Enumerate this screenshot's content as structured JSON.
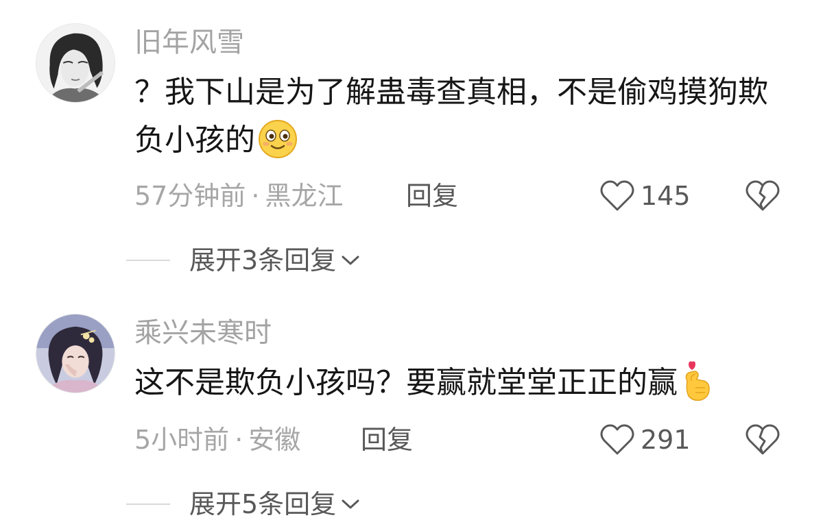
{
  "comments": [
    {
      "username": "旧年风雪",
      "content": "？我下山是为了解蛊毒查真相，不是偷鸡摸狗欺负小孩的",
      "content_emoji": "smiling-face-emoji",
      "time": "57分钟前",
      "separator": "·",
      "region": "黑龙江",
      "reply_label": "回复",
      "like_count": "145",
      "expand_label": "展开3条回复",
      "icons": {
        "like": "heart-outline-icon",
        "dislike": "broken-heart-icon",
        "expand": "chevron-down-icon"
      }
    },
    {
      "username": "乘兴未寒时",
      "content": "这不是欺负小孩吗？要赢就堂堂正正的赢",
      "content_emoji": "finger-heart-emoji",
      "time": "5小时前",
      "separator": "·",
      "region": "安徽",
      "reply_label": "回复",
      "like_count": "291",
      "expand_label": "展开5条回复",
      "icons": {
        "like": "heart-outline-icon",
        "dislike": "broken-heart-icon",
        "expand": "chevron-down-icon"
      }
    }
  ],
  "colors": {
    "username": "#a3a3a3",
    "content": "#161616",
    "meta": "#a6a6a6",
    "action": "#585858",
    "divider": "#d9d9d9"
  }
}
